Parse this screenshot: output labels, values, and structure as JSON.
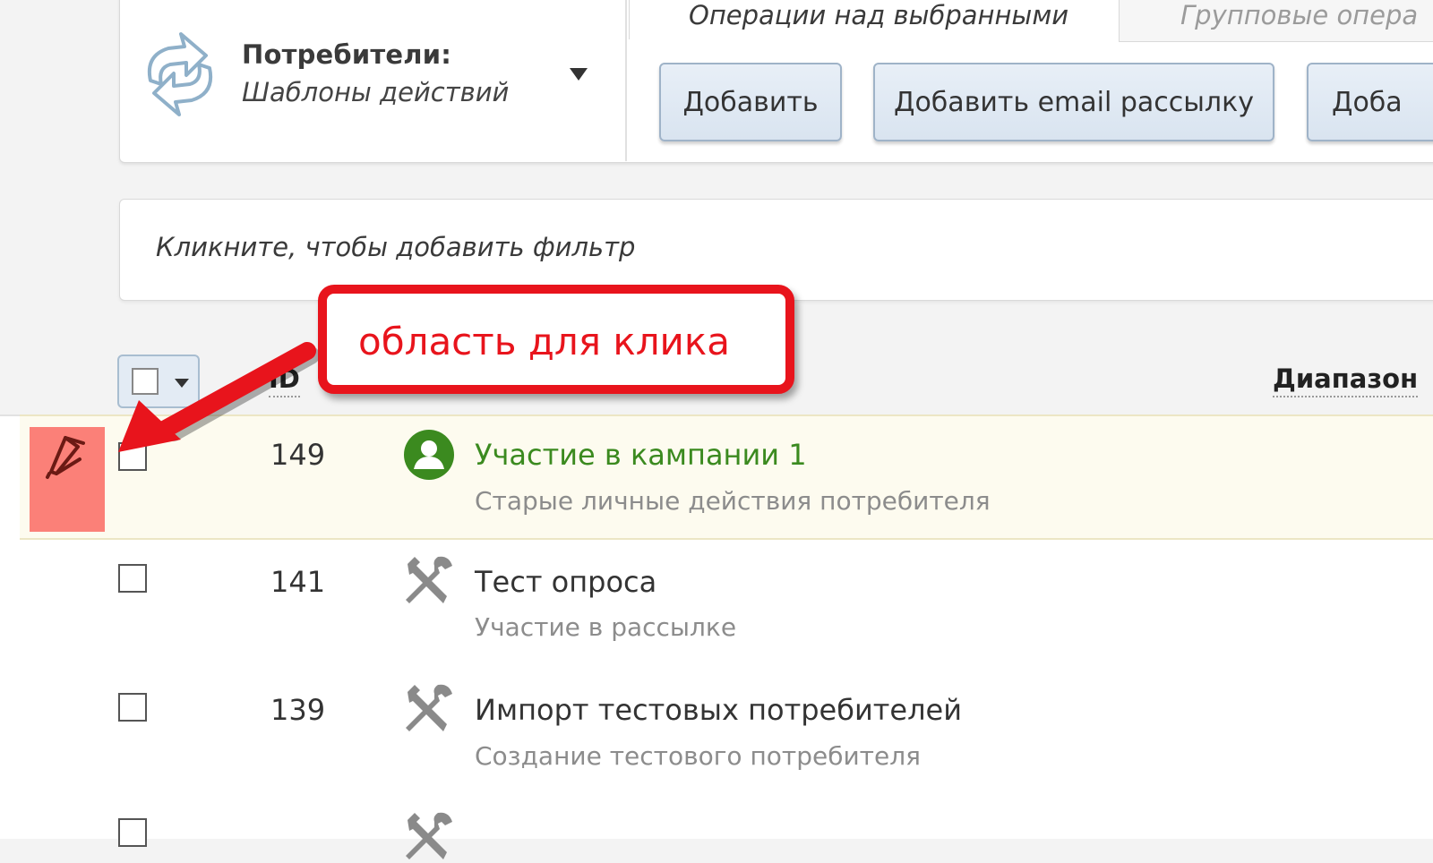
{
  "header": {
    "section_title": "Потребители:",
    "section_subtitle": "Шаблоны действий",
    "ops_tab_label": "Операции над выбранными",
    "group_tab_label": "Групповые опера",
    "buttons": {
      "add": "Добавить",
      "add_email": "Добавить email рассылку",
      "add_more": "Доба"
    }
  },
  "filter": {
    "placeholder": "Кликните, чтобы добавить фильтр"
  },
  "table": {
    "columns": {
      "id": "ID",
      "range": "Диапазон"
    },
    "rows": [
      {
        "id": "149",
        "title": "Участие в кампании 1",
        "subtitle": "Старые личные действия потребителя",
        "icon": "user-icon",
        "highlighted": true
      },
      {
        "id": "141",
        "title": "Тест опроса",
        "subtitle": "Участие в рассылке",
        "icon": "tools-icon",
        "highlighted": false
      },
      {
        "id": "139",
        "title": "Импорт тестовых потребителей",
        "subtitle": "Создание тестового потребителя",
        "icon": "tools-icon",
        "highlighted": false
      }
    ]
  },
  "annotation": {
    "callout_text": "область для клика",
    "color": "#e8141c"
  },
  "colors": {
    "link_green": "#3b8a1f",
    "handle_red": "#fb8078",
    "button_bg": "#dfe8f2"
  }
}
